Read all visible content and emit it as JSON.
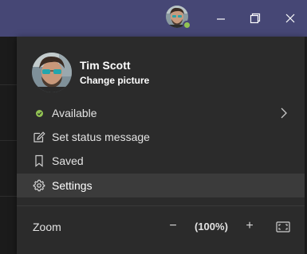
{
  "titlebar": {
    "avatar_icon": "user-avatar",
    "status": "available",
    "minimize_icon": "minimize-icon",
    "restore_icon": "restore-icon",
    "close_icon": "close-icon",
    "bar_color": "#464775"
  },
  "profile": {
    "name": "Tim Scott",
    "change_picture": "Change picture"
  },
  "menu": {
    "items": [
      {
        "label": "Available",
        "icon": "status-available-icon",
        "has_submenu": true
      },
      {
        "label": "Set status message",
        "icon": "edit-icon"
      },
      {
        "label": "Saved",
        "icon": "bookmark-icon"
      },
      {
        "label": "Settings",
        "icon": "gear-icon",
        "highlighted": true
      }
    ]
  },
  "zoom": {
    "label": "Zoom",
    "minus": "−",
    "value": "(100%)",
    "plus": "+",
    "fit_icon": "fit-to-window-icon"
  },
  "colors": {
    "accent_bar": "#464775",
    "status_available": "#92c353",
    "menu_bg": "#2b2b2b",
    "hover_bg": "#3b3b3b"
  }
}
